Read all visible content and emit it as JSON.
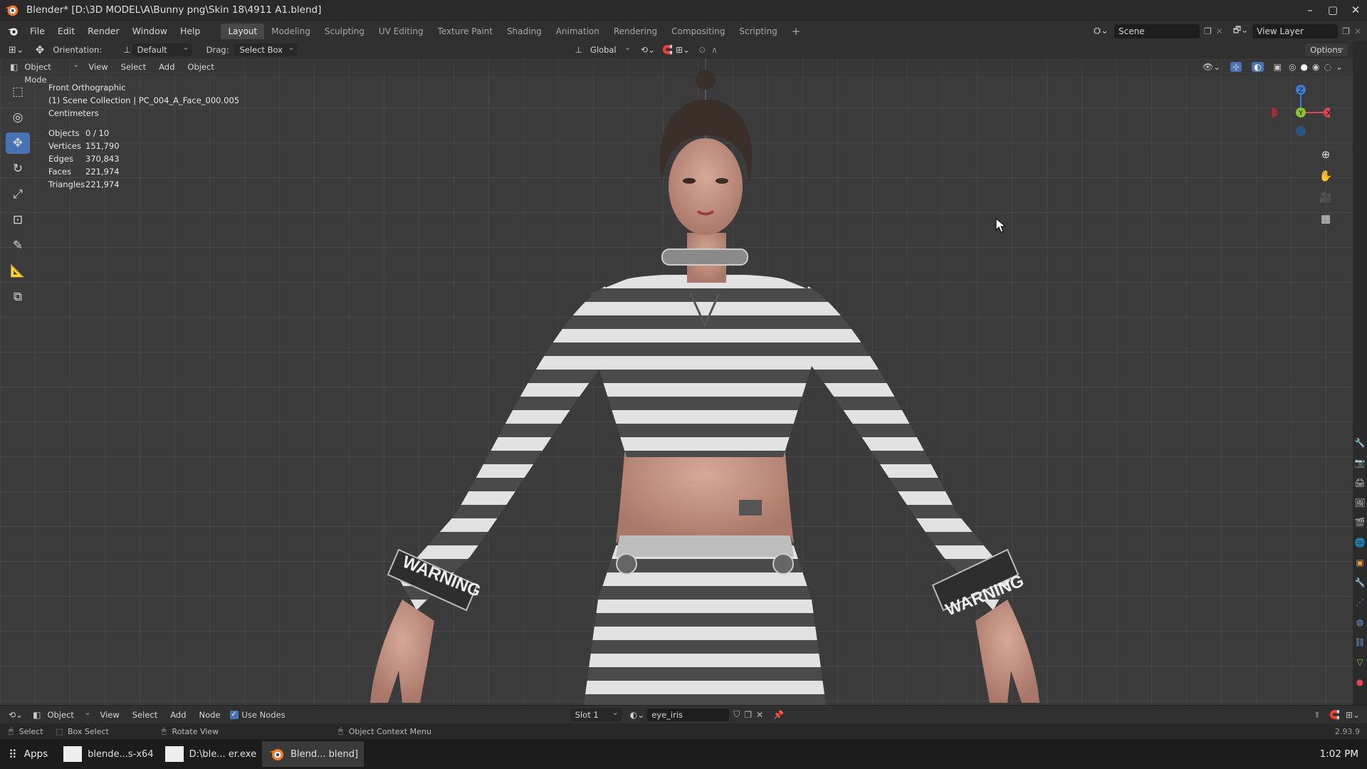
{
  "window": {
    "title": "Blender* [D:\\3D MODEL\\A\\Bunny png\\Skin 18\\4911 A1.blend]",
    "minimize": "–",
    "maximize": "▢",
    "close": "✕"
  },
  "menu": {
    "items": [
      "File",
      "Edit",
      "Render",
      "Window",
      "Help"
    ]
  },
  "workspaces": {
    "tabs": [
      "Layout",
      "Modeling",
      "Sculpting",
      "UV Editing",
      "Texture Paint",
      "Shading",
      "Animation",
      "Rendering",
      "Compositing",
      "Scripting"
    ],
    "active": "Layout",
    "add": "+"
  },
  "scene": {
    "label": "Scene",
    "view_layer": "View Layer"
  },
  "toolbar": {
    "orientation_label": "Orientation:",
    "orientation_value": "Default",
    "drag_label": "Drag:",
    "drag_value": "Select Box",
    "transform_value": "Global",
    "options": "Options"
  },
  "viewport_header": {
    "mode": "Object Mode",
    "view": "View",
    "select": "Select",
    "add": "Add",
    "object": "Object"
  },
  "overlay": {
    "view_name": "Front Orthographic",
    "collection": "(1) Scene Collection | PC_004_A_Face_000.005",
    "units": "Centimeters",
    "stats": [
      {
        "label": "Objects",
        "value": "0 / 10"
      },
      {
        "label": "Vertices",
        "value": "151,790"
      },
      {
        "label": "Edges",
        "value": "370,843"
      },
      {
        "label": "Faces",
        "value": "221,974"
      },
      {
        "label": "Triangles",
        "value": "221,974"
      }
    ]
  },
  "gizmo": {
    "z": "Z",
    "y": "Y",
    "x": "X"
  },
  "node_header": {
    "object": "Object",
    "view": "View",
    "select": "Select",
    "add": "Add",
    "node": "Node",
    "use_nodes": "Use Nodes",
    "slot": "Slot 1",
    "material": "eye_iris"
  },
  "statusbar": {
    "select": "Select",
    "box_select": "Box Select",
    "rotate_view": "Rotate View",
    "context_menu": "Object Context Menu",
    "version": "2.93.9"
  },
  "taskbar": {
    "apps": "Apps",
    "items": [
      "blende...s-x64",
      "D:\\ble... er.exe",
      "Blend... blend]"
    ],
    "time": "1:02 PM"
  },
  "character": {
    "wrist_text": "WARNING"
  },
  "colors": {
    "accent": "#4772b3",
    "x_axis": "#e3434b",
    "y_axis": "#89c52b",
    "z_axis": "#3a7fd1"
  }
}
